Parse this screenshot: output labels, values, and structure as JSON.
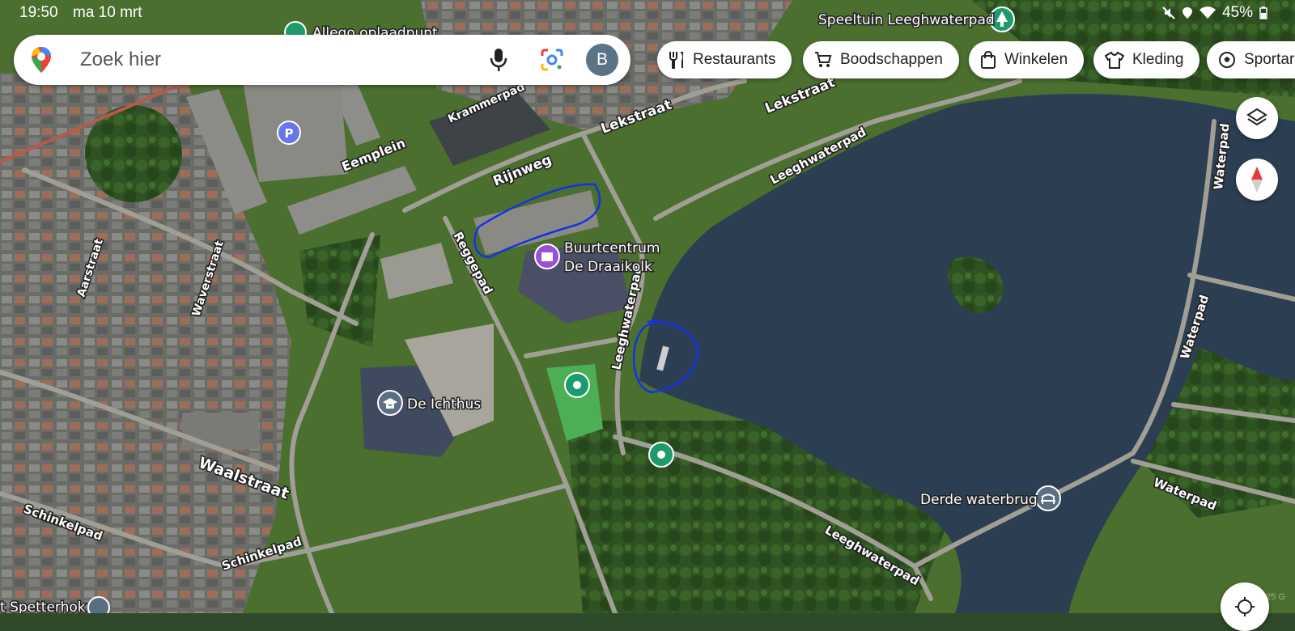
{
  "status": {
    "time": "19:50",
    "date": "ma 10 mrt",
    "battery": "45%"
  },
  "search": {
    "placeholder": "Zoek hier",
    "account_initial": "B"
  },
  "chips": [
    {
      "label": "Restaurants",
      "icon": "fork-knife-icon"
    },
    {
      "label": "Boodschappen",
      "icon": "cart-icon"
    },
    {
      "label": "Winkelen",
      "icon": "shopping-bag-icon"
    },
    {
      "label": "Kleding",
      "icon": "shirt-icon"
    },
    {
      "label": "Sportar",
      "icon": "soccer-ball-icon"
    }
  ],
  "map": {
    "streets": [
      "Rijnweg",
      "Lekstraat",
      "Lekstraat",
      "Krammerpad",
      "Eemplein",
      "Reggepad",
      "Leeghwaterpad",
      "Leeghwaterpad",
      "Leeghwaterpad",
      "Waalstraat",
      "Waverstraat",
      "Aarstraat",
      "Schinkelpad",
      "Schinkelpad",
      "Waterpad",
      "Waterpad",
      "Waterpad"
    ],
    "places": {
      "speeltuin": "Speeltuin Leeghwaterpad",
      "oplaadpunt": "Allego oplaadpunt",
      "buurtcentrum_line1": "Buurtcentrum",
      "buurtcentrum_line2": "De Draaikolk",
      "school": "De Ichthus",
      "bridge": "Derde waterbrug",
      "bottom_left": "t Spetterhok"
    },
    "copyright": "© 2025 G"
  },
  "colors": {
    "water": "#2c3f52",
    "grass": "#4f7a32",
    "trees": "#2b4a1f",
    "path": "#9a9a90",
    "annotation": "#1531e8",
    "poi_green": "#1e9b6c",
    "poi_purple": "#9c4fd6"
  }
}
